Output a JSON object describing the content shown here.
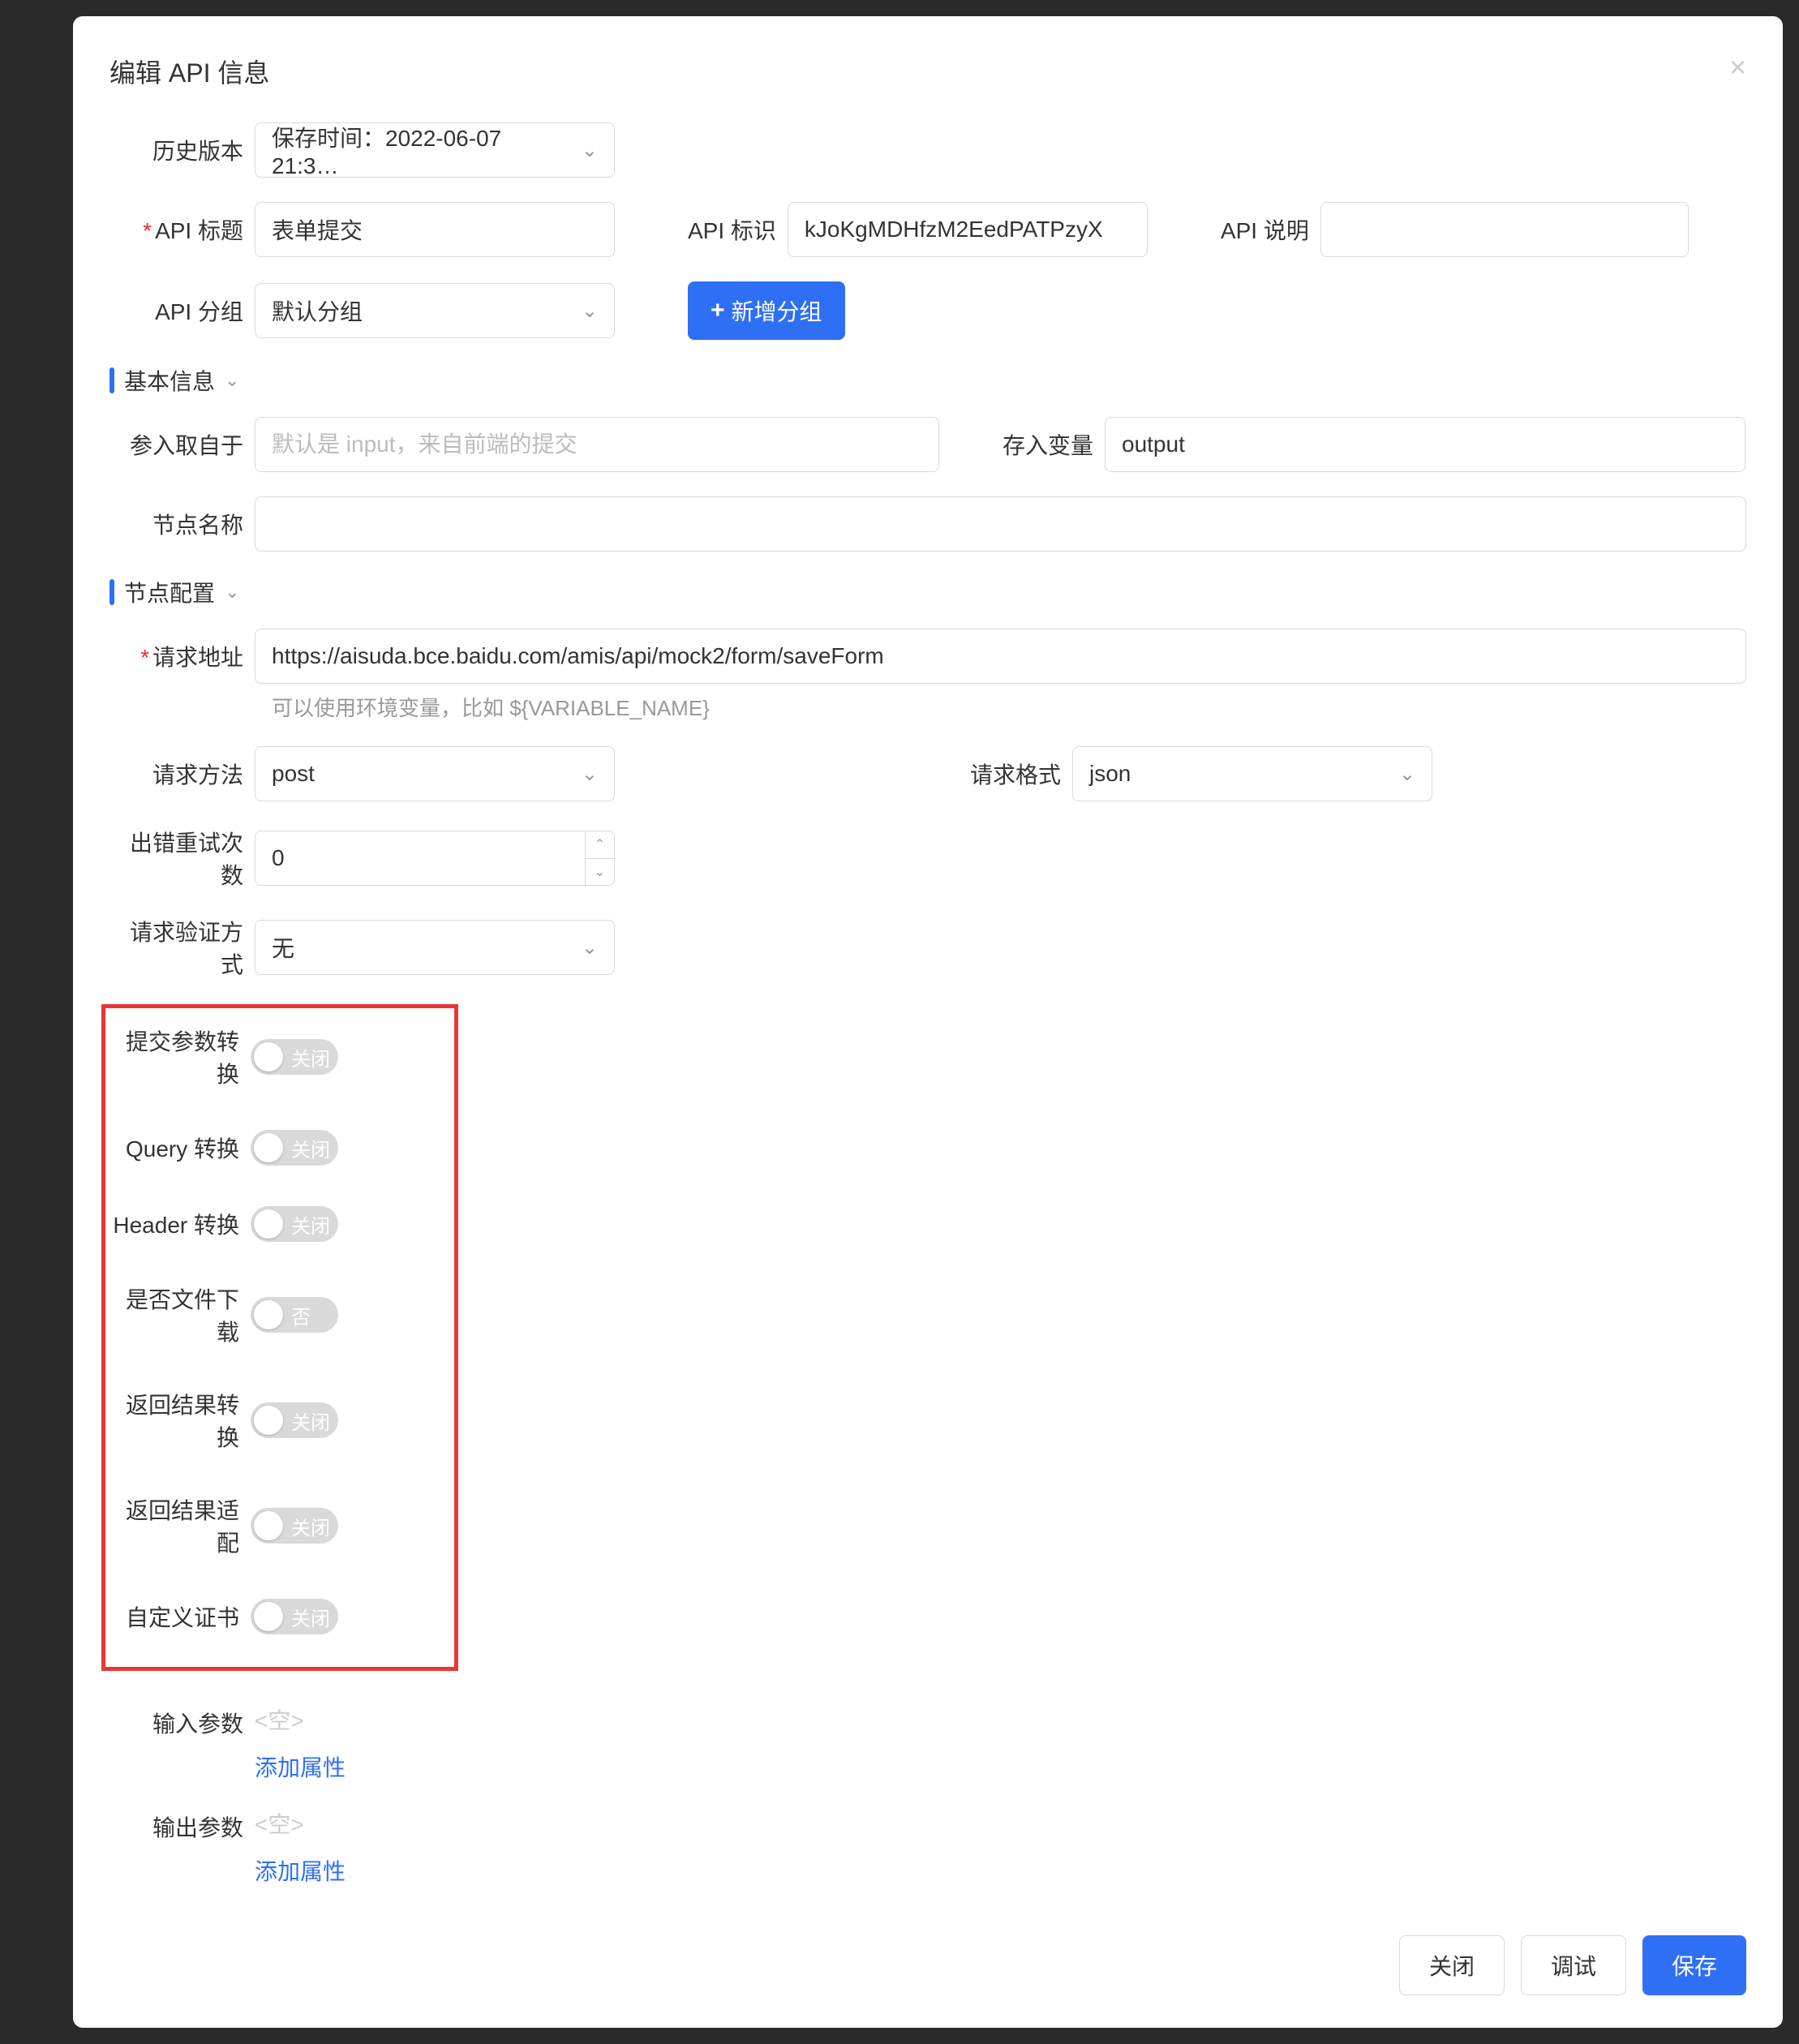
{
  "modal": {
    "title": "编辑 API 信息"
  },
  "history": {
    "label": "历史版本",
    "value": "保存时间：2022-06-07 21:3…"
  },
  "apiTitle": {
    "label": "API 标题",
    "value": "表单提交"
  },
  "apiIdent": {
    "label": "API 标识",
    "value": "kJoKgMDHfzM2EedPATPzyX"
  },
  "apiDesc": {
    "label": "API 说明",
    "value": ""
  },
  "apiGroup": {
    "label": "API 分组",
    "value": "默认分组",
    "addButton": "新增分组"
  },
  "sections": {
    "basic": "基本信息",
    "node": "节点配置"
  },
  "basic": {
    "inputFrom": {
      "label": "参入取自于",
      "placeholder": "默认是 input，来自前端的提交"
    },
    "storeVar": {
      "label": "存入变量",
      "value": "output"
    },
    "nodeName": {
      "label": "节点名称",
      "value": ""
    }
  },
  "node": {
    "reqUrl": {
      "label": "请求地址",
      "value": "https://aisuda.bce.baidu.com/amis/api/mock2/form/saveForm",
      "help": "可以使用环境变量，比如 ${VARIABLE_NAME}"
    },
    "reqMethod": {
      "label": "请求方法",
      "value": "post"
    },
    "reqFormat": {
      "label": "请求格式",
      "value": "json"
    },
    "retryCount": {
      "label": "出错重试次数",
      "value": "0"
    },
    "authMethod": {
      "label": "请求验证方式",
      "value": "无"
    }
  },
  "toggles": {
    "submitTransform": {
      "label": "提交参数转换",
      "state": "关闭"
    },
    "queryTransform": {
      "label": "Query 转换",
      "state": "关闭"
    },
    "headerTransform": {
      "label": "Header 转换",
      "state": "关闭"
    },
    "fileDownload": {
      "label": "是否文件下载",
      "state": "否"
    },
    "resultTransform": {
      "label": "返回结果转换",
      "state": "关闭"
    },
    "resultAdapt": {
      "label": "返回结果适配",
      "state": "关闭"
    },
    "customCert": {
      "label": "自定义证书",
      "state": "关闭"
    }
  },
  "params": {
    "input": {
      "label": "输入参数",
      "empty": "<空>",
      "addLink": "添加属性"
    },
    "output": {
      "label": "输出参数",
      "empty": "<空>",
      "addLink": "添加属性"
    }
  },
  "footer": {
    "close": "关闭",
    "debug": "调试",
    "save": "保存"
  }
}
